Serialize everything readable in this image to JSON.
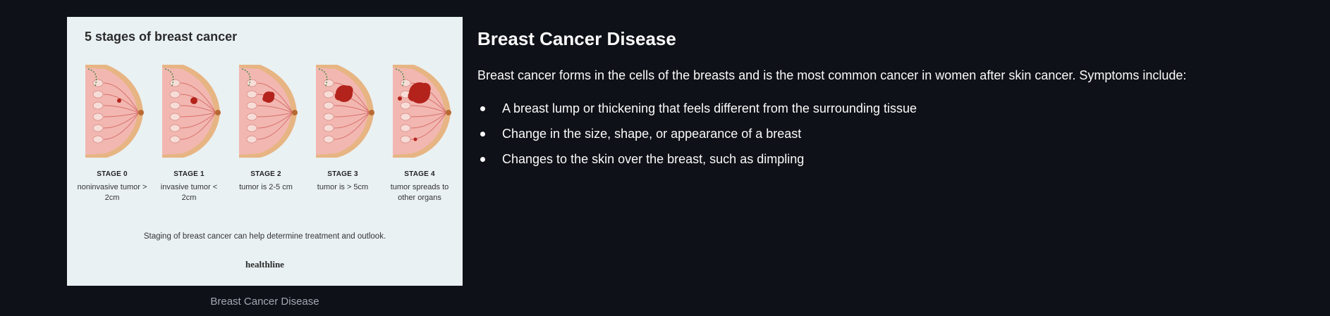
{
  "figure": {
    "title": "5 stages of breast cancer",
    "stages": [
      {
        "label": "STAGE 0",
        "desc": "noninvasive tumor > 2cm",
        "tumor_level": 0
      },
      {
        "label": "STAGE 1",
        "desc": "invasive tumor < 2cm",
        "tumor_level": 1
      },
      {
        "label": "STAGE 2",
        "desc": "tumor is 2-5 cm",
        "tumor_level": 2
      },
      {
        "label": "STAGE 3",
        "desc": "tumor is > 5cm",
        "tumor_level": 3
      },
      {
        "label": "STAGE 4",
        "desc": "tumor spreads to other organs",
        "tumor_level": 4
      }
    ],
    "caption": "Staging of breast cancer can help determine treatment and outlook.",
    "brand": "healthline"
  },
  "image_caption": "Breast Cancer Disease",
  "content": {
    "heading": "Breast Cancer Disease",
    "intro": "Breast cancer forms in the cells of the breasts and is the most common cancer in women after skin cancer. Symptoms include:",
    "symptoms": [
      "A breast lump or thickening that feels different from the surrounding tissue",
      "Change in the size, shape, or appearance of a breast",
      "Changes to the skin over the breast, such as dimpling"
    ]
  },
  "colors": {
    "page_bg": "#0e1117",
    "figure_bg": "#eaf1f3",
    "tissue": "#f2b7b1",
    "skin": "#e7b583",
    "tumor": "#b3231c",
    "caption_text": "#a3a8b4"
  }
}
